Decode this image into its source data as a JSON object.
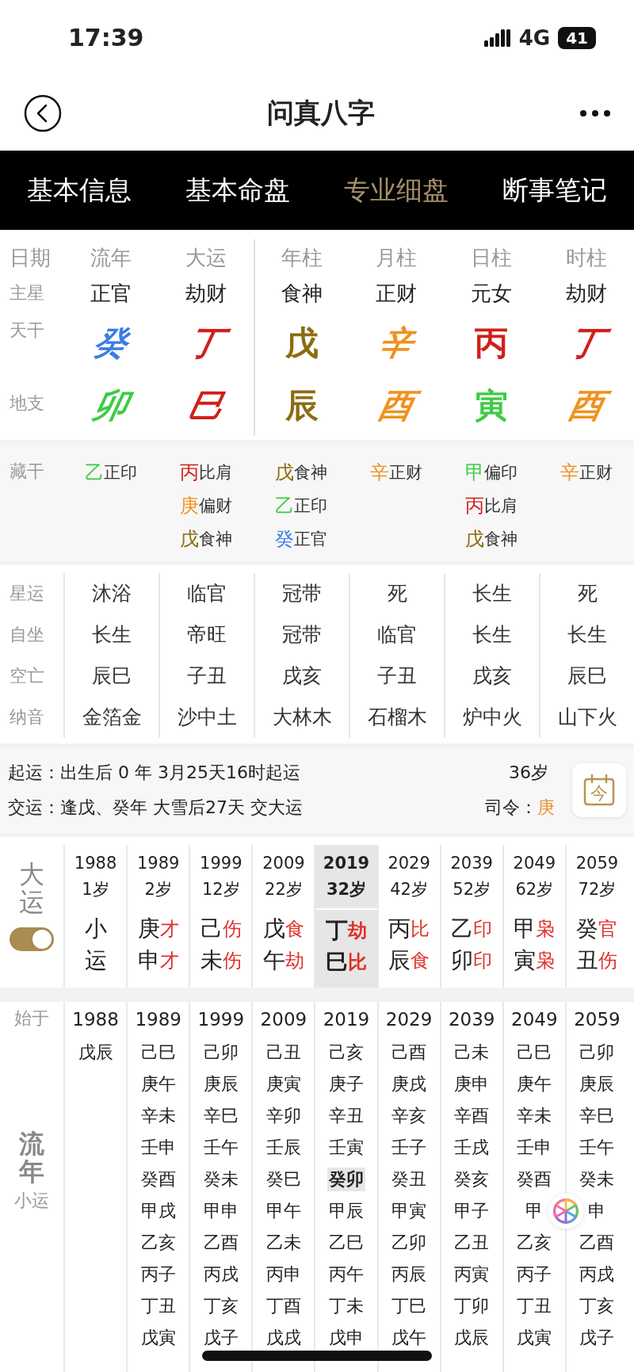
{
  "status_bar": {
    "time": "17:39",
    "network": "4G",
    "battery": "41"
  },
  "nav": {
    "title": "问真八字"
  },
  "tabs": [
    {
      "label": "基本信息",
      "selected": false
    },
    {
      "label": "基本命盘",
      "selected": false
    },
    {
      "label": "专业细盘",
      "selected": true
    },
    {
      "label": "断事笔记",
      "selected": false
    }
  ],
  "pillars": {
    "row_labels": [
      "日期",
      "主星",
      "天干",
      "地支"
    ],
    "hidden_label": "藏干",
    "detail_labels": [
      "星运",
      "自坐",
      "空亡",
      "纳音"
    ],
    "columns": [
      {
        "header": "流年",
        "main_star": "正官",
        "stem": {
          "text": "癸",
          "color": "#3a7de6",
          "italic": true
        },
        "branch": {
          "text": "卯",
          "color": "#3ecb45",
          "italic": true
        },
        "hidden": [
          {
            "stem": "乙",
            "color": "#3ecb45",
            "god": "正印"
          }
        ],
        "details": [
          "沐浴",
          "长生",
          "辰巳",
          "金箔金"
        ]
      },
      {
        "header": "大运",
        "main_star": "劫财",
        "stem": {
          "text": "丁",
          "color": "#d0201a",
          "italic": true
        },
        "branch": {
          "text": "巳",
          "color": "#d0201a",
          "italic": true
        },
        "hidden": [
          {
            "stem": "丙",
            "color": "#d0201a",
            "god": "比肩"
          },
          {
            "stem": "庚",
            "color": "#f0921e",
            "god": "偏财"
          },
          {
            "stem": "戊",
            "color": "#8c6c12",
            "god": "食神"
          }
        ],
        "details": [
          "临官",
          "帝旺",
          "子丑",
          "沙中土"
        ]
      },
      {
        "header": "年柱",
        "main_star": "食神",
        "stem": {
          "text": "戊",
          "color": "#8c6c12",
          "italic": false
        },
        "branch": {
          "text": "辰",
          "color": "#8c6c12",
          "italic": false
        },
        "hidden": [
          {
            "stem": "戊",
            "color": "#8c6c12",
            "god": "食神"
          },
          {
            "stem": "乙",
            "color": "#3ecb45",
            "god": "正印"
          },
          {
            "stem": "癸",
            "color": "#3a7de6",
            "god": "正官"
          }
        ],
        "details": [
          "冠带",
          "冠带",
          "戌亥",
          "大林木"
        ]
      },
      {
        "header": "月柱",
        "main_star": "正财",
        "stem": {
          "text": "辛",
          "color": "#f0921e",
          "italic": true
        },
        "branch": {
          "text": "酉",
          "color": "#f0921e",
          "italic": true
        },
        "hidden": [
          {
            "stem": "辛",
            "color": "#f0921e",
            "god": "正财"
          }
        ],
        "details": [
          "死",
          "临官",
          "子丑",
          "石榴木"
        ]
      },
      {
        "header": "日柱",
        "main_star": "元女",
        "stem": {
          "text": "丙",
          "color": "#d0201a",
          "italic": false
        },
        "branch": {
          "text": "寅",
          "color": "#3ecb45",
          "italic": false
        },
        "hidden": [
          {
            "stem": "甲",
            "color": "#3ecb45",
            "god": "偏印"
          },
          {
            "stem": "丙",
            "color": "#d0201a",
            "god": "比肩"
          },
          {
            "stem": "戊",
            "color": "#8c6c12",
            "god": "食神"
          }
        ],
        "details": [
          "长生",
          "长生",
          "戌亥",
          "炉中火"
        ]
      },
      {
        "header": "时柱",
        "main_star": "劫财",
        "stem": {
          "text": "丁",
          "color": "#d0201a",
          "italic": true
        },
        "branch": {
          "text": "酉",
          "color": "#f0921e",
          "italic": true
        },
        "hidden": [
          {
            "stem": "辛",
            "color": "#f0921e",
            "god": "正财"
          }
        ],
        "details": [
          "死",
          "长生",
          "辰巳",
          "山下火"
        ]
      }
    ]
  },
  "luck_info": {
    "start_label": "起运：",
    "start_text": "出生后 0 年 3月25天16时起运",
    "age": "36岁",
    "change_label": "交运：",
    "change_text": "逢戊、癸年 大雪后27天 交大运",
    "commander_label": "司令：",
    "commander": "庚",
    "today_icon": "今"
  },
  "dayun": {
    "label": "大运",
    "toggle": {
      "on": true
    },
    "columns": [
      {
        "year": "1988",
        "age": "1岁",
        "stem": "小",
        "branch": "运",
        "selected": false
      },
      {
        "year": "1989",
        "age": "2岁",
        "stem": "庚",
        "stem_god": "才",
        "branch": "申",
        "branch_god": "才",
        "selected": false
      },
      {
        "year": "1999",
        "age": "12岁",
        "stem": "己",
        "stem_god": "伤",
        "branch": "未",
        "branch_god": "伤",
        "selected": false
      },
      {
        "year": "2009",
        "age": "22岁",
        "stem": "戊",
        "stem_god": "食",
        "branch": "午",
        "branch_god": "劫",
        "selected": false
      },
      {
        "year": "2019",
        "age": "32岁",
        "stem": "丁",
        "stem_god": "劫",
        "branch": "巳",
        "branch_god": "比",
        "selected": true
      },
      {
        "year": "2029",
        "age": "42岁",
        "stem": "丙",
        "stem_god": "比",
        "branch": "辰",
        "branch_god": "食",
        "selected": false
      },
      {
        "year": "2039",
        "age": "52岁",
        "stem": "乙",
        "stem_god": "印",
        "branch": "卯",
        "branch_god": "印",
        "selected": false
      },
      {
        "year": "2049",
        "age": "62岁",
        "stem": "甲",
        "stem_god": "枭",
        "branch": "寅",
        "branch_god": "枭",
        "selected": false
      },
      {
        "year": "2059",
        "age": "72岁",
        "stem": "癸",
        "stem_god": "官",
        "branch": "丑",
        "branch_god": "伤",
        "selected": false
      }
    ]
  },
  "liunian": {
    "start_label": "始于",
    "label": "流年",
    "sub_label": "小运",
    "columns": [
      {
        "year": "1988",
        "items": [
          {
            "text": "戊辰",
            "selected": false
          }
        ]
      },
      {
        "year": "1989",
        "items": [
          {
            "text": "己巳",
            "selected": false
          },
          {
            "text": "庚午",
            "selected": false
          },
          {
            "text": "辛未",
            "selected": false
          },
          {
            "text": "壬申",
            "selected": false
          },
          {
            "text": "癸酉",
            "selected": false
          },
          {
            "text": "甲戌",
            "selected": false
          },
          {
            "text": "乙亥",
            "selected": false
          },
          {
            "text": "丙子",
            "selected": false
          },
          {
            "text": "丁丑",
            "selected": false
          },
          {
            "text": "戊寅",
            "selected": false
          }
        ]
      },
      {
        "year": "1999",
        "items": [
          {
            "text": "己卯",
            "selected": false
          },
          {
            "text": "庚辰",
            "selected": false
          },
          {
            "text": "辛巳",
            "selected": false
          },
          {
            "text": "壬午",
            "selected": false
          },
          {
            "text": "癸未",
            "selected": false
          },
          {
            "text": "甲申",
            "selected": false
          },
          {
            "text": "乙酉",
            "selected": false
          },
          {
            "text": "丙戌",
            "selected": false
          },
          {
            "text": "丁亥",
            "selected": false
          },
          {
            "text": "戊子",
            "selected": false
          }
        ]
      },
      {
        "year": "2009",
        "items": [
          {
            "text": "己丑",
            "selected": false
          },
          {
            "text": "庚寅",
            "selected": false
          },
          {
            "text": "辛卯",
            "selected": false
          },
          {
            "text": "壬辰",
            "selected": false
          },
          {
            "text": "癸巳",
            "selected": false
          },
          {
            "text": "甲午",
            "selected": false
          },
          {
            "text": "乙未",
            "selected": false
          },
          {
            "text": "丙申",
            "selected": false
          },
          {
            "text": "丁酉",
            "selected": false
          },
          {
            "text": "戊戌",
            "selected": false
          }
        ]
      },
      {
        "year": "2019",
        "items": [
          {
            "text": "己亥",
            "selected": false
          },
          {
            "text": "庚子",
            "selected": false
          },
          {
            "text": "辛丑",
            "selected": false
          },
          {
            "text": "壬寅",
            "selected": false
          },
          {
            "text": "癸卯",
            "selected": true
          },
          {
            "text": "甲辰",
            "selected": false
          },
          {
            "text": "乙巳",
            "selected": false
          },
          {
            "text": "丙午",
            "selected": false
          },
          {
            "text": "丁未",
            "selected": false
          },
          {
            "text": "戊申",
            "selected": false
          }
        ]
      },
      {
        "year": "2029",
        "items": [
          {
            "text": "己酉",
            "selected": false
          },
          {
            "text": "庚戌",
            "selected": false
          },
          {
            "text": "辛亥",
            "selected": false
          },
          {
            "text": "壬子",
            "selected": false
          },
          {
            "text": "癸丑",
            "selected": false
          },
          {
            "text": "甲寅",
            "selected": false
          },
          {
            "text": "乙卯",
            "selected": false
          },
          {
            "text": "丙辰",
            "selected": false
          },
          {
            "text": "丁巳",
            "selected": false
          },
          {
            "text": "戊午",
            "selected": false
          }
        ]
      },
      {
        "year": "2039",
        "items": [
          {
            "text": "己未",
            "selected": false
          },
          {
            "text": "庚申",
            "selected": false
          },
          {
            "text": "辛酉",
            "selected": false
          },
          {
            "text": "壬戌",
            "selected": false
          },
          {
            "text": "癸亥",
            "selected": false
          },
          {
            "text": "甲子",
            "selected": false
          },
          {
            "text": "乙丑",
            "selected": false
          },
          {
            "text": "丙寅",
            "selected": false
          },
          {
            "text": "丁卯",
            "selected": false
          },
          {
            "text": "戊辰",
            "selected": false
          }
        ]
      },
      {
        "year": "2049",
        "items": [
          {
            "text": "己巳",
            "selected": false
          },
          {
            "text": "庚午",
            "selected": false
          },
          {
            "text": "辛未",
            "selected": false
          },
          {
            "text": "壬申",
            "selected": false
          },
          {
            "text": "癸酉",
            "selected": false
          },
          {
            "text": "甲",
            "selected": false
          },
          {
            "text": "乙亥",
            "selected": false
          },
          {
            "text": "丙子",
            "selected": false
          },
          {
            "text": "丁丑",
            "selected": false
          },
          {
            "text": "戊寅",
            "selected": false
          }
        ]
      },
      {
        "year": "2059",
        "items": [
          {
            "text": "己卯",
            "selected": false
          },
          {
            "text": "庚辰",
            "selected": false
          },
          {
            "text": "辛巳",
            "selected": false
          },
          {
            "text": "壬午",
            "selected": false
          },
          {
            "text": "癸未",
            "selected": false
          },
          {
            "text": "申",
            "selected": false
          },
          {
            "text": "乙酉",
            "selected": false
          },
          {
            "text": "丙戌",
            "selected": false
          },
          {
            "text": "丁亥",
            "selected": false
          },
          {
            "text": "戊子",
            "selected": false
          }
        ]
      }
    ]
  }
}
